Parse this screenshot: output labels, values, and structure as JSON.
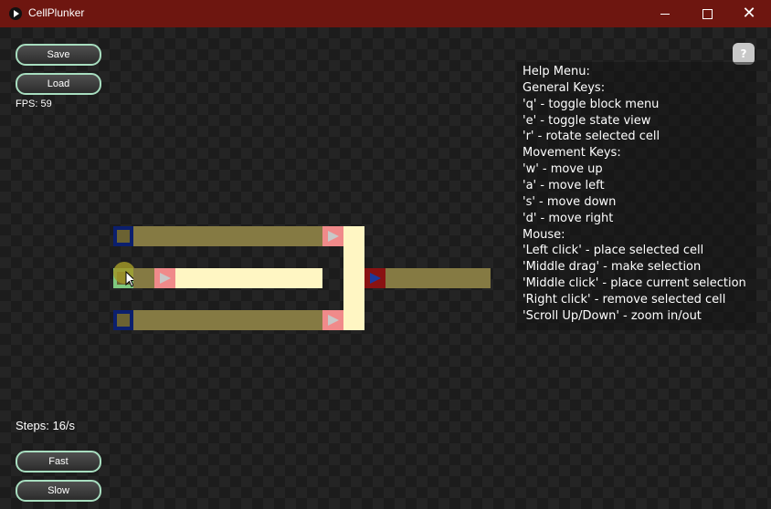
{
  "window": {
    "title": "CellPlunker"
  },
  "buttons": {
    "save": "Save",
    "load": "Load",
    "fast": "Fast",
    "slow": "Slow",
    "help": "?"
  },
  "status": {
    "fps": "FPS: 59",
    "steps": "Steps: 16/s"
  },
  "help_menu": [
    "Help Menu:",
    "General Keys:",
    "'q' - toggle block menu",
    "'e' - toggle state view",
    "'r' - rotate selected cell",
    "Movement Keys:",
    "'w' - move up",
    "'a' - move left",
    "'s' - move down",
    "'d' - move right",
    "Mouse:",
    "'Left click' - place selected cell",
    "'Middle drag' - make selection",
    "'Middle click' - place current selection",
    "'Right click' - remove selected cell",
    "'Scroll Up/Down' - zoom in/out"
  ],
  "colors": {
    "titlebar": "#6e1610",
    "wire_off": "#857a43",
    "wire_on": "#fff6c3",
    "source": "#f08a8a",
    "button_border": "#a8dec0"
  },
  "icons": [
    "play-icon",
    "minimize-icon",
    "maximize-icon",
    "close-icon",
    "cursor-icon"
  ]
}
